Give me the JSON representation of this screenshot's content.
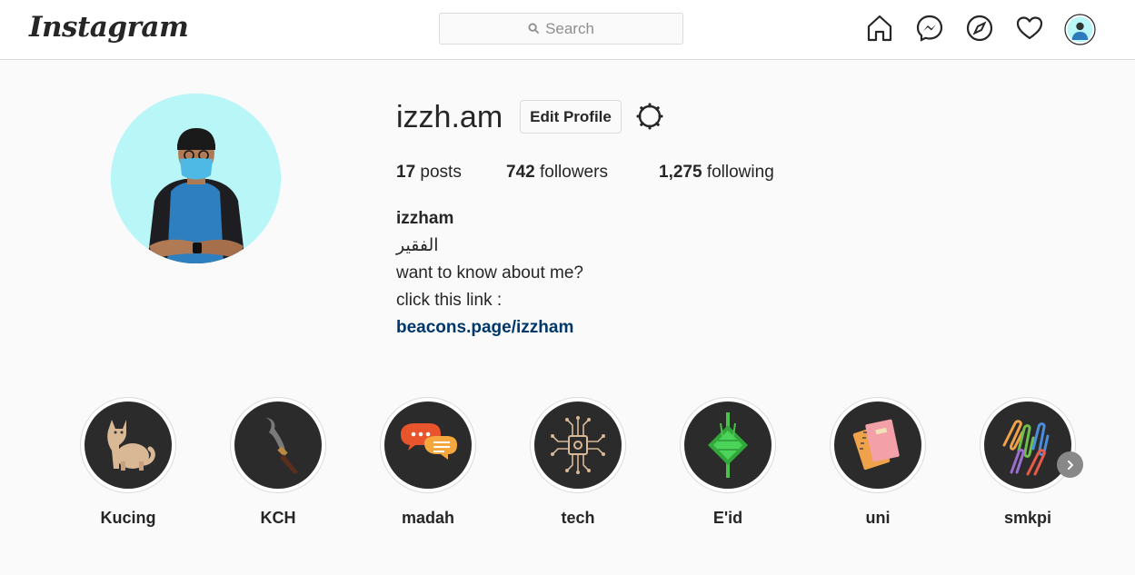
{
  "header": {
    "logo": "Instagram",
    "search_placeholder": "Search",
    "nav": [
      "home-icon",
      "messenger-icon",
      "explore-icon",
      "activity-heart-icon",
      "profile-avatar"
    ]
  },
  "profile": {
    "username": "izzh.am",
    "edit_label": "Edit Profile",
    "stats": {
      "posts_count": "17",
      "posts_label": "posts",
      "followers_count": "742",
      "followers_label": "followers",
      "following_count": "1,275",
      "following_label": "following"
    },
    "bio": {
      "name": "izzham",
      "line1": "الفقير",
      "line2": "want to know about me?",
      "line3": "click this link :",
      "link": "beacons.page/izzham"
    }
  },
  "highlights": [
    {
      "label": "Kucing",
      "icon": "cat-icon"
    },
    {
      "label": "KCH",
      "icon": "knife-icon"
    },
    {
      "label": "madah",
      "icon": "chat-bubbles-icon"
    },
    {
      "label": "tech",
      "icon": "circuit-icon"
    },
    {
      "label": "E'id",
      "icon": "ketupat-icon"
    },
    {
      "label": "uni",
      "icon": "notebooks-icon"
    },
    {
      "label": "smkpi",
      "icon": "paperclips-icon"
    }
  ],
  "colors": {
    "link": "#00376b",
    "avatar_bg": "#b9f6f8",
    "highlight_bg": "#2b2b2b"
  }
}
